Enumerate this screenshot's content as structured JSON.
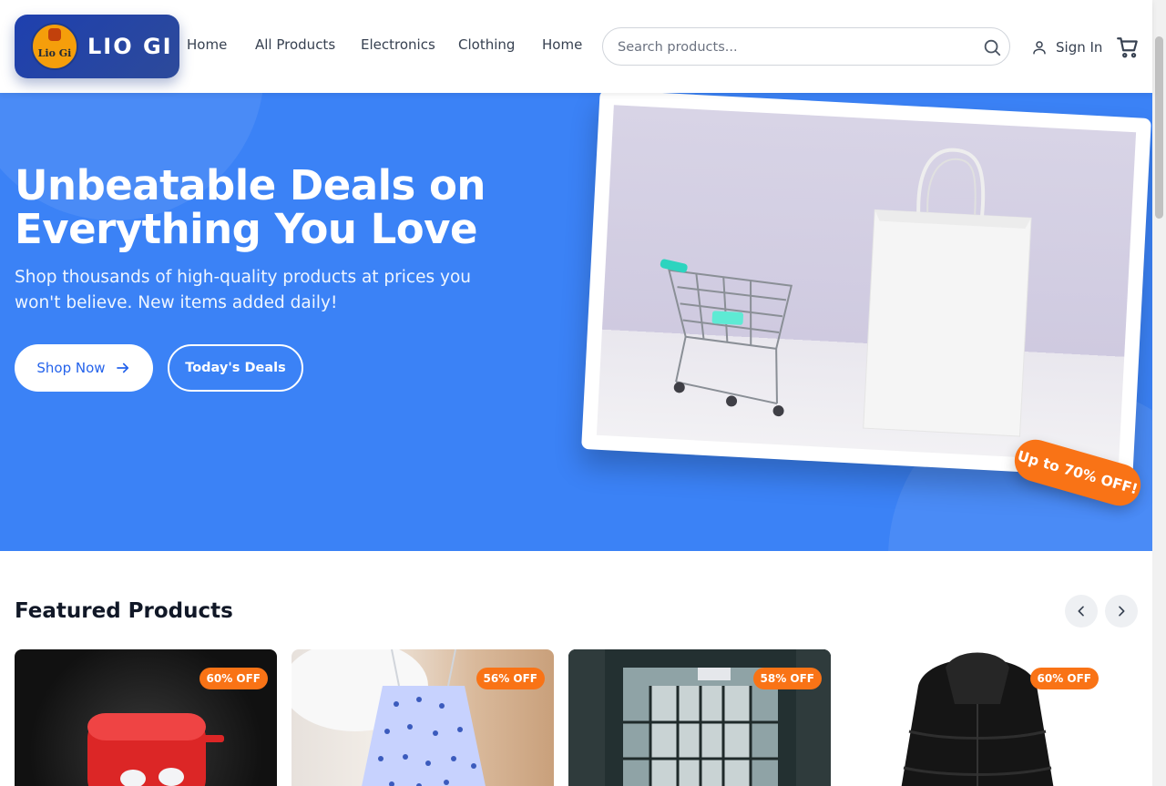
{
  "brand": {
    "logo_badge_text": "Lio Gi",
    "name": "LIO GI"
  },
  "nav": {
    "items": [
      "Home",
      "All Products",
      "Electronics",
      "Clothing",
      "Home"
    ]
  },
  "search": {
    "placeholder": "Search products..."
  },
  "account": {
    "sign_in": "Sign In"
  },
  "hero": {
    "title": "Unbeatable Deals on Everything You Love",
    "subtitle": "Shop thousands of high-quality products at prices you won't believe. New items added daily!",
    "shop_now": "Shop Now",
    "todays_deals": "Today's Deals",
    "badge": "Up to 70% OFF!"
  },
  "featured": {
    "title": "Featured Products",
    "products": [
      {
        "discount": "60% OFF",
        "icon": "earbuds-case"
      },
      {
        "discount": "56% OFF",
        "icon": "floral-dress"
      },
      {
        "discount": "58% OFF",
        "icon": "building-interior"
      },
      {
        "discount": "60% OFF",
        "icon": "puffer-jacket"
      }
    ]
  },
  "colors": {
    "hero_bg": "#3b82f6",
    "brand_navy": "#1e3a8a",
    "accent_orange": "#f97316"
  }
}
